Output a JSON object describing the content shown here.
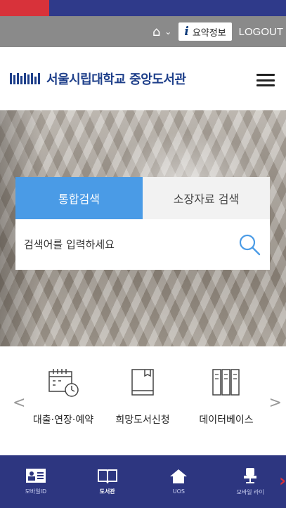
{
  "utility": {
    "info_label": "요약정보",
    "logout_label": "LOGOUT"
  },
  "header": {
    "title": "서울시립대학교 중앙도서관"
  },
  "search": {
    "tabs": [
      {
        "label": "통합검색",
        "active": true
      },
      {
        "label": "소장자료 검색",
        "active": false
      }
    ],
    "placeholder": "검색어를 입력하세요"
  },
  "quick_links": [
    {
      "label": "대출·연장·예약",
      "icon": "calendar-clock-icon"
    },
    {
      "label": "희망도서신청",
      "icon": "book-icon"
    },
    {
      "label": "데이터베이스",
      "icon": "database-icon"
    }
  ],
  "bottom_nav": [
    {
      "label": "모바일ID",
      "icon": "id-card-icon"
    },
    {
      "label": "도서관",
      "icon": "open-book-icon",
      "active": true
    },
    {
      "label": "UOS",
      "icon": "home-icon"
    },
    {
      "label": "모바일 라이",
      "icon": "seat-icon"
    }
  ],
  "colors": {
    "top_strip_red": "#d8323a",
    "top_strip_blue": "#2f3a8a",
    "brand_blue": "#1e3f8a",
    "active_tab": "#4a9be6",
    "nav_bg": "#2d3680"
  }
}
